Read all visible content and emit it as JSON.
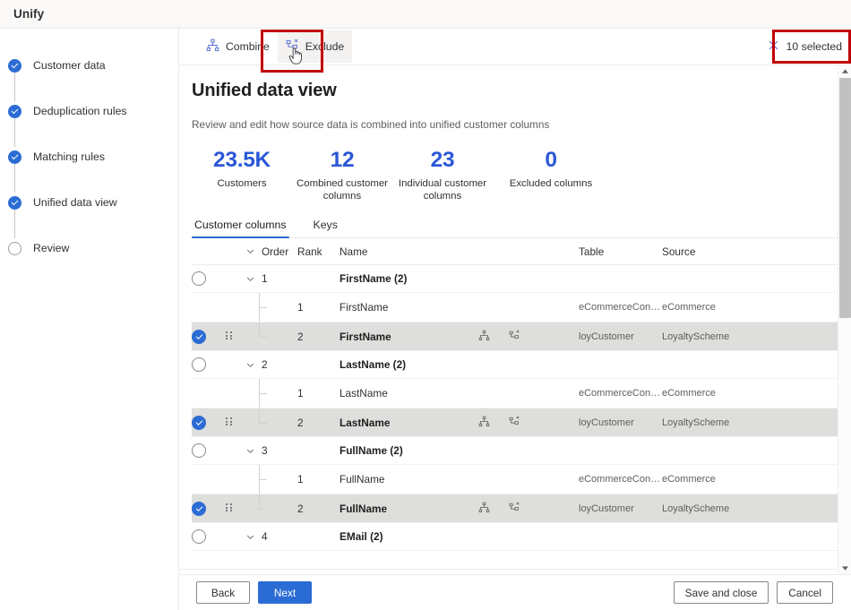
{
  "window": {
    "title": "Unify"
  },
  "wizard": {
    "steps": [
      {
        "label": "Customer data",
        "state": "done"
      },
      {
        "label": "Deduplication rules",
        "state": "done"
      },
      {
        "label": "Matching rules",
        "state": "done"
      },
      {
        "label": "Unified data view",
        "state": "done"
      },
      {
        "label": "Review",
        "state": "pending"
      }
    ]
  },
  "commandbar": {
    "combine_label": "Combine",
    "exclude_label": "Exclude",
    "selected_label": "10 selected",
    "combine_icon": "combine-hierarchy-icon",
    "exclude_icon": "exclude-hierarchy-icon",
    "clear_icon": "close-x-icon"
  },
  "page": {
    "title": "Unified data view",
    "subtitle": "Review and edit how source data is combined into unified customer columns"
  },
  "stats": [
    {
      "value": "23.5K",
      "label": "Customers"
    },
    {
      "value": "12",
      "label": "Combined customer columns"
    },
    {
      "value": "23",
      "label": "Individual customer columns"
    },
    {
      "value": "0",
      "label": "Excluded columns"
    }
  ],
  "tabs": [
    {
      "label": "Customer columns",
      "active": true
    },
    {
      "label": "Keys",
      "active": false
    }
  ],
  "table": {
    "headers": {
      "expand": "chevron-down-icon",
      "order": "Order",
      "rank": "Rank",
      "name": "Name",
      "table": "Table",
      "source": "Source"
    },
    "rows": [
      {
        "type": "group",
        "order": "1",
        "name": "FirstName (2)",
        "checked": false
      },
      {
        "type": "child",
        "rank": "1",
        "name": "FirstName",
        "table": "eCommerceConta...",
        "source": "eCommerce",
        "checked": false,
        "selected": false,
        "icons": false
      },
      {
        "type": "child",
        "rank": "2",
        "name": "FirstName",
        "table": "loyCustomer",
        "source": "LoyaltyScheme",
        "checked": true,
        "selected": true,
        "icons": true
      },
      {
        "type": "group",
        "order": "2",
        "name": "LastName (2)",
        "checked": false
      },
      {
        "type": "child",
        "rank": "1",
        "name": "LastName",
        "table": "eCommerceConta...",
        "source": "eCommerce",
        "checked": false,
        "selected": false,
        "icons": false
      },
      {
        "type": "child",
        "rank": "2",
        "name": "LastName",
        "table": "loyCustomer",
        "source": "LoyaltyScheme",
        "checked": true,
        "selected": true,
        "icons": true
      },
      {
        "type": "group",
        "order": "3",
        "name": "FullName (2)",
        "checked": false
      },
      {
        "type": "child",
        "rank": "1",
        "name": "FullName",
        "table": "eCommerceConta...",
        "source": "eCommerce",
        "checked": false,
        "selected": false,
        "icons": false
      },
      {
        "type": "child",
        "rank": "2",
        "name": "FullName",
        "table": "loyCustomer",
        "source": "LoyaltyScheme",
        "checked": true,
        "selected": true,
        "icons": true
      },
      {
        "type": "group",
        "order": "4",
        "name": "EMail (2)",
        "checked": false
      }
    ],
    "row_icons": {
      "combine": "combine-hierarchy-icon",
      "exclude": "exclude-hierarchy-icon",
      "drag": "drag-handle-icon"
    }
  },
  "footer": {
    "back": "Back",
    "next": "Next",
    "save_and_close": "Save and close",
    "cancel": "Cancel"
  },
  "colors": {
    "accent": "#2b6cd4",
    "stat_value": "#2b57d6",
    "highlight_box": "#c00000",
    "selected_row": "#dededc"
  }
}
